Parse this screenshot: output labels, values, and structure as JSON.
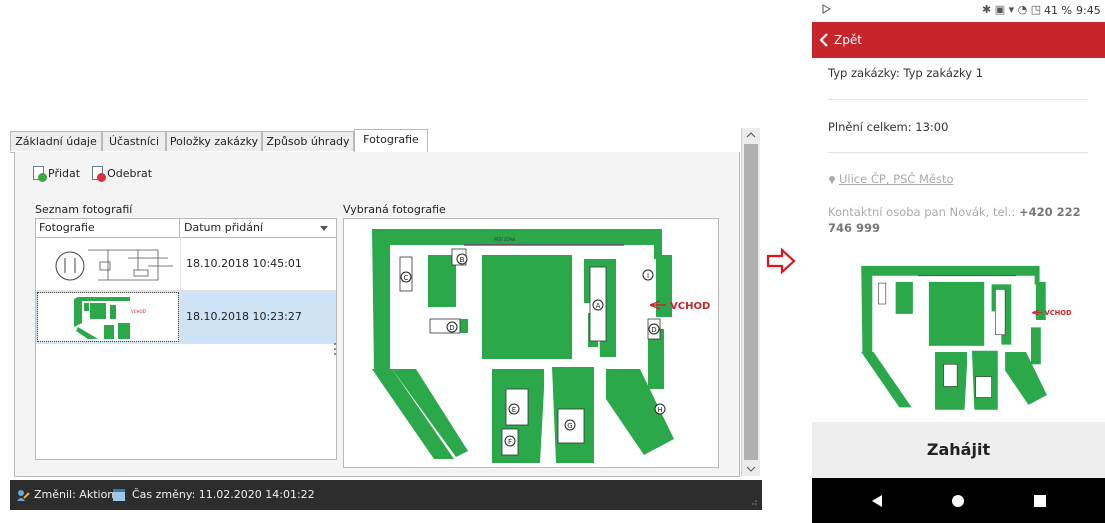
{
  "desktop": {
    "tabs": [
      "Základní údaje",
      "Účastníci",
      "Položky zakázky",
      "Způsob úhrady",
      "Fotografie"
    ],
    "active_tab": "Fotografie",
    "toolbar": {
      "add_label": "Přidat",
      "remove_label": "Odebrat"
    },
    "list_group_title": "Seznam fotografií",
    "columns": [
      "Fotografie",
      "Datum přidání"
    ],
    "rows": [
      {
        "date": "18.10.2018 10:45:01",
        "thumb": "diagram"
      },
      {
        "date": "18.10.2018 10:23:27",
        "thumb": "map"
      }
    ],
    "preview_group_title": "Vybraná fotografie",
    "map_labels": {
      "entrance": "VCHOD",
      "zone": "PĚŠÍ ZÓNA",
      "markers": [
        "A",
        "B",
        "C",
        "D",
        "E",
        "F",
        "G",
        "H",
        "I"
      ]
    },
    "status": {
      "changed_by": "Změnil: Aktion",
      "changed_time": "Čas změny: 11.02.2020 14:01:22"
    }
  },
  "phone": {
    "status_bar": {
      "battery": "41 %",
      "time": "9:45"
    },
    "back_label": "Zpět",
    "order_type": "Typ zakázky: Typ zakázky 1",
    "total": "Plnění celkem: 13:00",
    "address": "Ulice ČP, PSČ Město",
    "contact_text": "Kontaktní osoba pan Novák, tel.: ",
    "contact_phone": "+420 222 746 999",
    "start_button": "Zahájit"
  },
  "colors": {
    "accent_red": "#c7252a",
    "map_green": "#2aa84a",
    "selection": "#cfe3f7",
    "status_bar": "#2d2d2d"
  }
}
